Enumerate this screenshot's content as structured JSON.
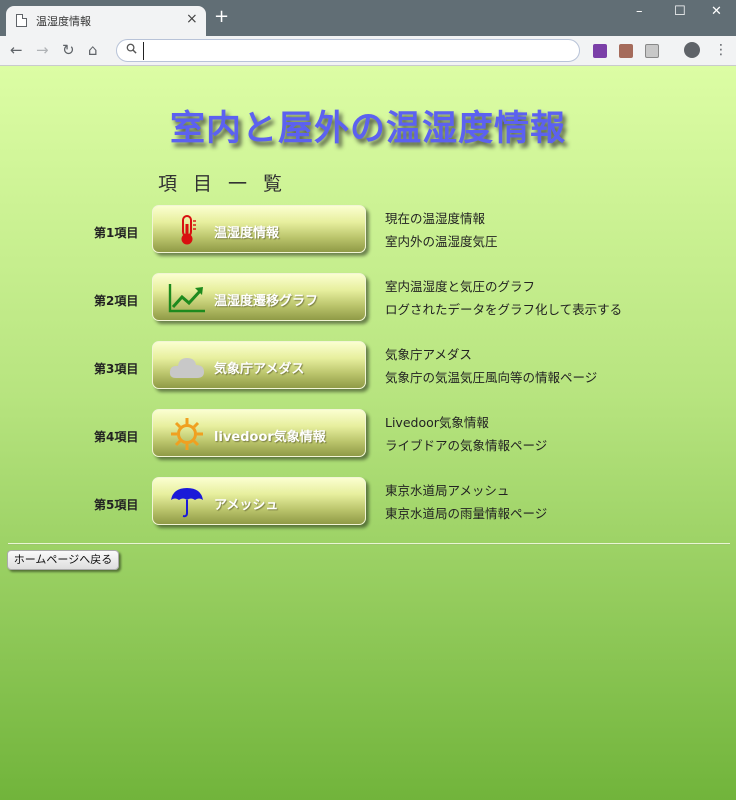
{
  "browser": {
    "tab_title": "温湿度情報",
    "tab_close": "×",
    "new_tab": "+",
    "window_controls": {
      "minimize": "–",
      "maximize": "☐",
      "close": "✕"
    },
    "nav": {
      "back": "←",
      "forward": "→",
      "reload": "↻",
      "home": "⌂"
    },
    "address_bar": {
      "value": "",
      "placeholder": "",
      "search_glyph": "🔍"
    },
    "menu_glyph": "⋮"
  },
  "page": {
    "title": "室内と屋外の温湿度情報",
    "list_heading": "項目一覧",
    "items": [
      {
        "label": "第1項目",
        "button": "温湿度情報",
        "icon": "thermometer-icon",
        "desc1": "現在の温湿度情報",
        "desc2": "室内外の温湿度気圧"
      },
      {
        "label": "第2項目",
        "button": "温湿度遷移グラフ",
        "icon": "trend-chart-icon",
        "desc1": "室内温湿度と気圧のグラフ",
        "desc2": "ログされたデータをグラフ化して表示する"
      },
      {
        "label": "第3項目",
        "button": "気象庁アメダス",
        "icon": "cloud-icon",
        "desc1": "気象庁アメダス",
        "desc2": "気象庁の気温気圧風向等の情報ページ"
      },
      {
        "label": "第4項目",
        "button": "livedoor気象情報",
        "icon": "sun-icon",
        "desc1": "Livedoor気象情報",
        "desc2": "ライブドアの気象情報ページ"
      },
      {
        "label": "第5項目",
        "button": "アメッシュ",
        "icon": "umbrella-icon",
        "desc1": "東京水道局アメッシュ",
        "desc2": "東京水道局の雨量情報ページ"
      }
    ],
    "home_button": "ホームページへ戻る"
  },
  "colors": {
    "title": "#5c61f0",
    "page_top": "#dcfda4",
    "page_bottom": "#71b43b",
    "button_top": "#fbffd0",
    "button_bottom": "#8f9a46"
  }
}
